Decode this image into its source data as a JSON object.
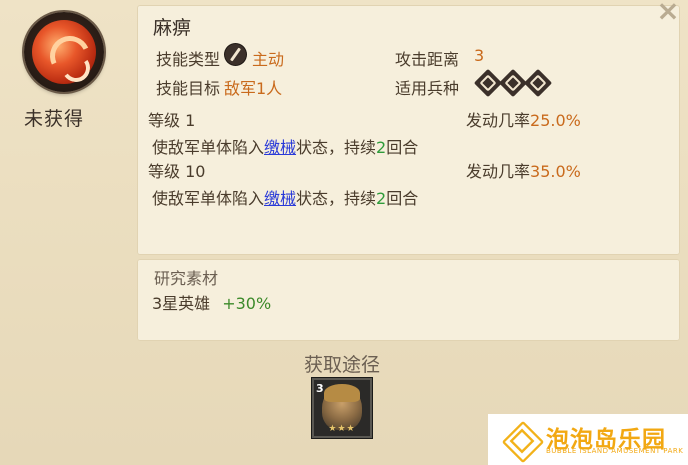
{
  "status": "未获得",
  "close_icon": "×",
  "skill": {
    "name": "麻痹",
    "type_label": "技能类型",
    "type_value": "主动",
    "range_label": "攻击距离",
    "range_value": "3",
    "target_label": "技能目标",
    "target_value": "敌军1人",
    "troop_label": "适用兵种",
    "troop_icons": [
      "sword-icon",
      "shield-icon",
      "bow-icon"
    ]
  },
  "levels": [
    {
      "label": "等级 1",
      "rate_label": "发动几率",
      "rate": "25.0%",
      "desc_pre": "使敌军单体陷入",
      "desc_link": "缴械",
      "desc_mid": "状态，持续",
      "desc_num": "2",
      "desc_post": "回合"
    },
    {
      "label": "等级 10",
      "rate_label": "发动几率",
      "rate": "35.0%",
      "desc_pre": "使敌军单体陷入",
      "desc_link": "缴械",
      "desc_mid": "状态，持续",
      "desc_num": "2",
      "desc_post": "回合"
    }
  ],
  "research": {
    "title": "研究素材",
    "item": "3星英雄",
    "bonus": "+30%"
  },
  "source": {
    "title": "获取途径",
    "hero_level": "3",
    "hero_stars": "★★★"
  },
  "watermark": {
    "cn": "泡泡岛乐园",
    "en": "BUBBLE ISLAND AMUSEMENT PARK"
  },
  "colors": {
    "value_orange": "#c96a1c",
    "highlight_green": "#2e9b3a",
    "link_blue": "#2a3ad8",
    "logo_gold": "#f2a812"
  }
}
